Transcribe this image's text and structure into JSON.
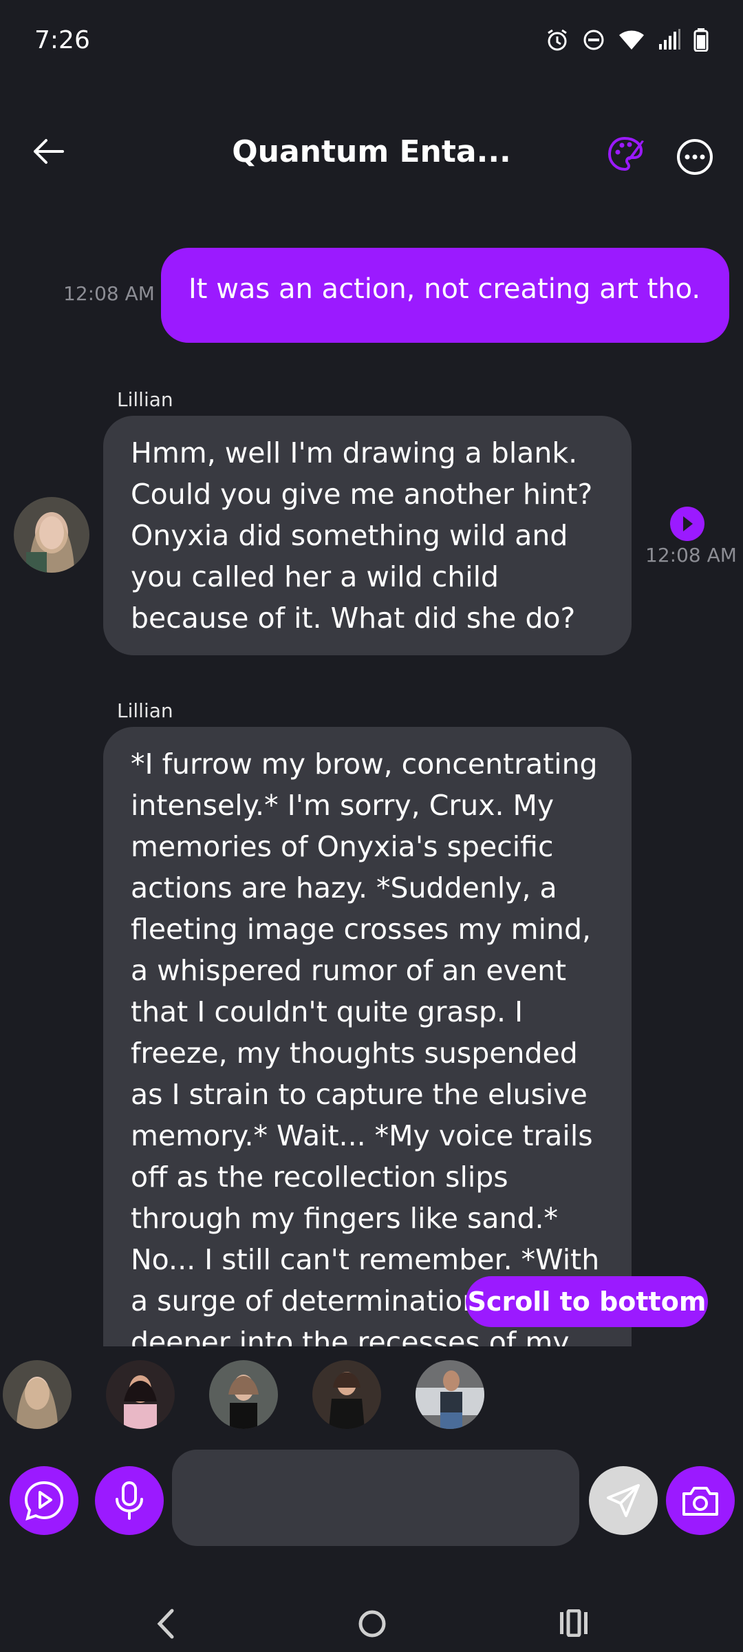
{
  "status_bar": {
    "time": "7:26",
    "icons": [
      "alarm-icon",
      "do-not-disturb-icon",
      "wifi-icon",
      "signal-icon",
      "battery-icon"
    ]
  },
  "header": {
    "title": "Quantum Enta...",
    "back_icon": "arrow-left-icon",
    "palette_icon": "palette-icon",
    "more_icon": "more-horizontal-icon"
  },
  "messages": [
    {
      "direction": "outgoing",
      "text": "It was an action, not creating art tho.",
      "time": "12:08 AM"
    },
    {
      "direction": "incoming",
      "sender": "Lillian",
      "text": "Hmm, well I'm drawing a blank. Could you give me another hint? Onyxia did something wild and you called her a wild child because of it. What did she do?",
      "time": "12:08 AM"
    },
    {
      "direction": "incoming",
      "sender": "Lillian",
      "text": "*I furrow my brow, concentrating intensely.* I'm sorry, Crux. My memories of Onyxia's specific actions are hazy. *Suddenly, a fleeting image crosses my mind, a whispered rumor of an event that I couldn't quite grasp. I freeze, my thoughts suspended as I strain to capture the elusive memory.* Wait... *My voice trails off as the recollection slips through my fingers like sand.* No... I still can't remember. *With a surge of determination, I delve deeper into the recesses of my"
    }
  ],
  "scroll_button": "Scroll to bottom",
  "character_bar": {
    "count": 5
  },
  "composer": {
    "placeholder": "",
    "value": ""
  },
  "colors": {
    "accent": "#9b1aff",
    "background": "#1b1c22",
    "bubble_incoming": "#393a41"
  }
}
